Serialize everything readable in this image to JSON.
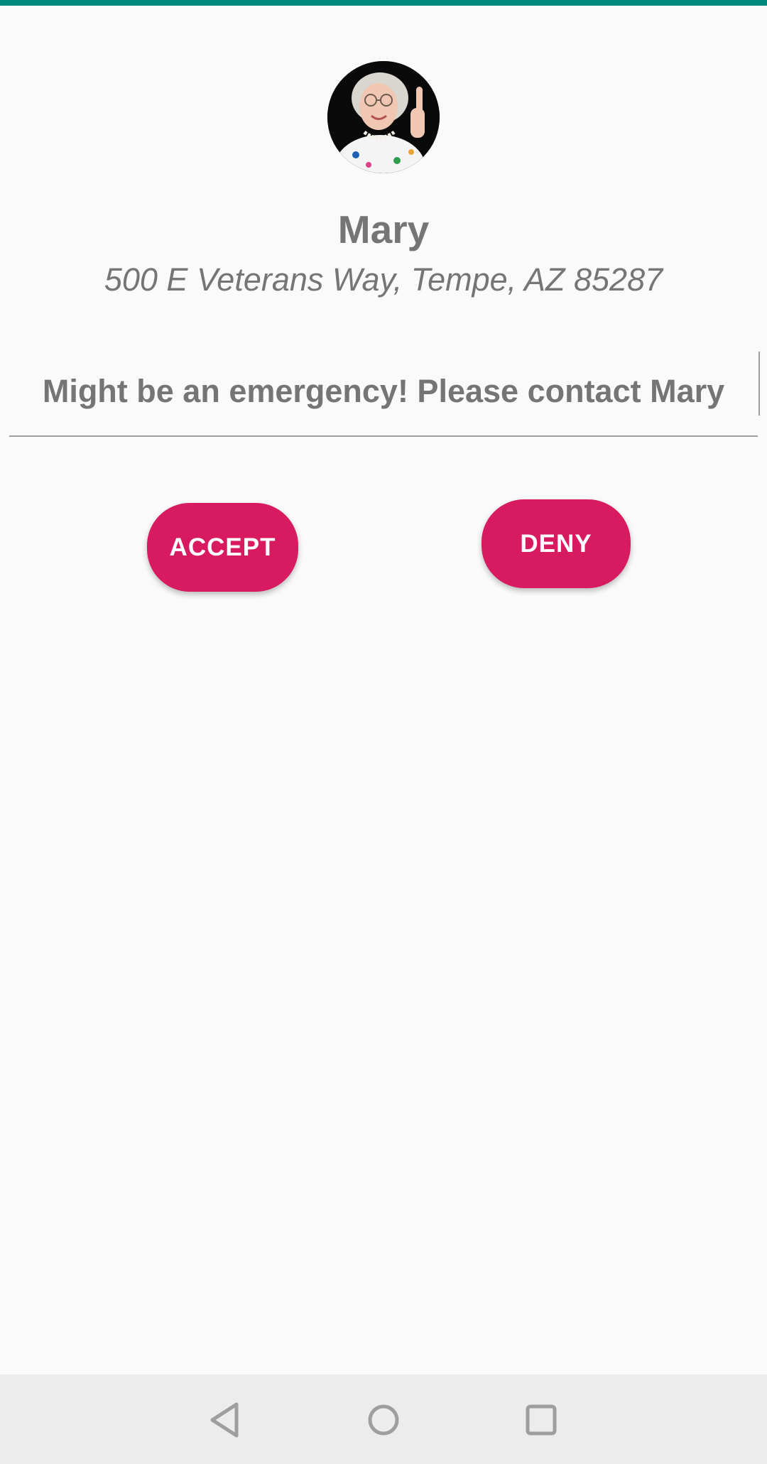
{
  "theme": {
    "accent_color": "#00897b",
    "button_color": "#d81b60",
    "text_color": "#757575",
    "nav_icon_color": "#9e9e9e"
  },
  "contact": {
    "avatar_icon": "person-photo-icon",
    "name": "Mary",
    "address": "500 E Veterans Way, Tempe, AZ 85287"
  },
  "message": {
    "value": "Might be an emergency! Please contact Mary"
  },
  "actions": {
    "accept_label": "ACCEPT",
    "deny_label": "DENY"
  },
  "navigation": {
    "back_icon": "back-triangle-icon",
    "home_icon": "home-circle-icon",
    "recents_icon": "recents-square-icon"
  }
}
